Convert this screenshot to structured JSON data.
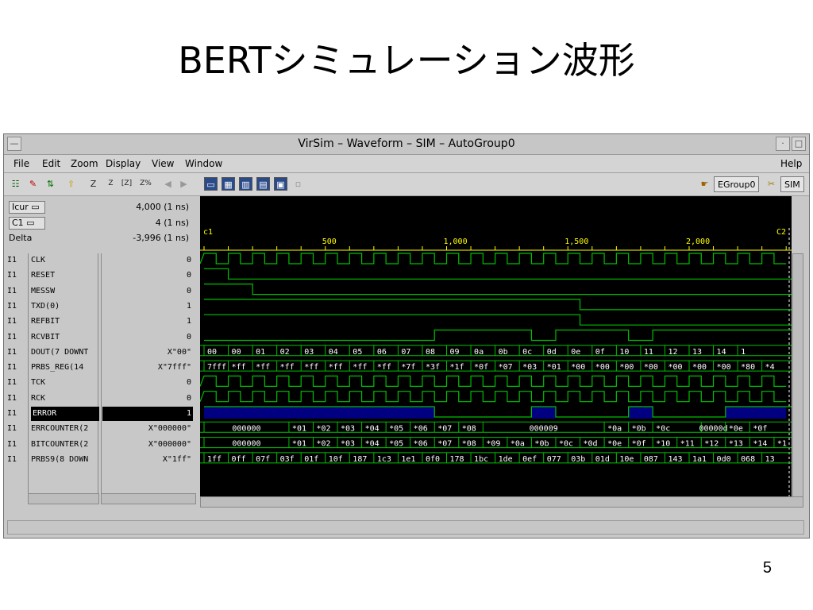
{
  "slide": {
    "title": "BERTシミュレーション波形",
    "page_number": "5"
  },
  "window": {
    "title": "VirSim – Waveform – SIM – AutoGroup0"
  },
  "menu": {
    "file": "File",
    "edit": "Edit",
    "zoom": "Zoom",
    "display": "Display",
    "view": "View",
    "window": "Window",
    "help": "Help"
  },
  "toolbar": {
    "group_button": "EGroup0",
    "sim_button": "SIM",
    "zoom_z": "Z",
    "zoom_z2": "Z",
    "zoom_fit": "[Z]",
    "zoom_pct": "Z%"
  },
  "cursors": {
    "icur_label": "Icur",
    "icur_value": "4,000 (1 ns)",
    "c1_label": "C1",
    "c1_value": "4 (1 ns)",
    "delta_label": "Delta",
    "delta_value": "-3,996 (1 ns)"
  },
  "signals": [
    {
      "group": "I1",
      "name": "CLK",
      "value": "0"
    },
    {
      "group": "I1",
      "name": "RESET",
      "value": "0"
    },
    {
      "group": "I1",
      "name": "MESSW",
      "value": "0"
    },
    {
      "group": "I1",
      "name": "TXD(0)",
      "value": "1"
    },
    {
      "group": "I1",
      "name": "REFBIT",
      "value": "1"
    },
    {
      "group": "I1",
      "name": "RCVBIT",
      "value": "0"
    },
    {
      "group": "I1",
      "name": "DOUT(7 DOWNT",
      "value": "X\"00\""
    },
    {
      "group": "I1",
      "name": "PRBS_REG(14",
      "value": "X\"7fff\""
    },
    {
      "group": "I1",
      "name": "TCK",
      "value": "0"
    },
    {
      "group": "I1",
      "name": "RCK",
      "value": "0"
    },
    {
      "group": "I1",
      "name": "ERROR",
      "value": "1"
    },
    {
      "group": "I1",
      "name": "ERRCOUNTER(2",
      "value": "X\"000000\""
    },
    {
      "group": "I1",
      "name": "BITCOUNTER(2",
      "value": "X\"000000\""
    },
    {
      "group": "I1",
      "name": "PRBS9(8 DOWN",
      "value": "X\"1ff\""
    }
  ],
  "timeline": {
    "ticks": [
      "500",
      "1,000",
      "1,500",
      "2,000"
    ],
    "cursor_c1": "c1",
    "cursor_c2": "C2"
  },
  "bus_dout": [
    "00",
    "00",
    "01",
    "02",
    "03",
    "04",
    "05",
    "06",
    "07",
    "08",
    "09",
    "0a",
    "0b",
    "0c",
    "0d",
    "0e",
    "0f",
    "10",
    "11",
    "12",
    "13",
    "14",
    "1"
  ],
  "bus_prbs_reg": [
    "7fff",
    "*ff",
    "*ff",
    "*ff",
    "*ff",
    "*ff",
    "*ff",
    "*ff",
    "*7f",
    "*3f",
    "*1f",
    "*0f",
    "*07",
    "*03",
    "*01",
    "*00",
    "*00",
    "*00",
    "*00",
    "*00",
    "*00",
    "*00",
    "*80",
    "*4"
  ],
  "bus_errcounter": [
    "000000",
    "*01",
    "*02",
    "*03",
    "*04",
    "*05",
    "*06",
    "*07",
    "*08",
    "000009",
    "*0a",
    "*0b",
    "*0c",
    "00000d",
    "*0e",
    "*0f"
  ],
  "bus_bitcounter": [
    "000000",
    "*01",
    "*02",
    "*03",
    "*04",
    "*05",
    "*06",
    "*07",
    "*08",
    "*09",
    "*0a",
    "*0b",
    "*0c",
    "*0d",
    "*0e",
    "*0f",
    "*10",
    "*11",
    "*12",
    "*13",
    "*14",
    "*1"
  ],
  "bus_prbs9": [
    "1ff",
    "0ff",
    "07f",
    "03f",
    "01f",
    "10f",
    "187",
    "1c3",
    "1e1",
    "0f0",
    "178",
    "1bc",
    "1de",
    "0ef",
    "077",
    "03b",
    "01d",
    "10e",
    "087",
    "143",
    "1a1",
    "0d0",
    "068",
    "13"
  ],
  "colors": {
    "wave": "#00c000",
    "bus_text": "#ffffff",
    "error_fill": "#000080",
    "cursor": "#ffff00",
    "timeline_text": "#ffff00",
    "background": "#000000"
  }
}
